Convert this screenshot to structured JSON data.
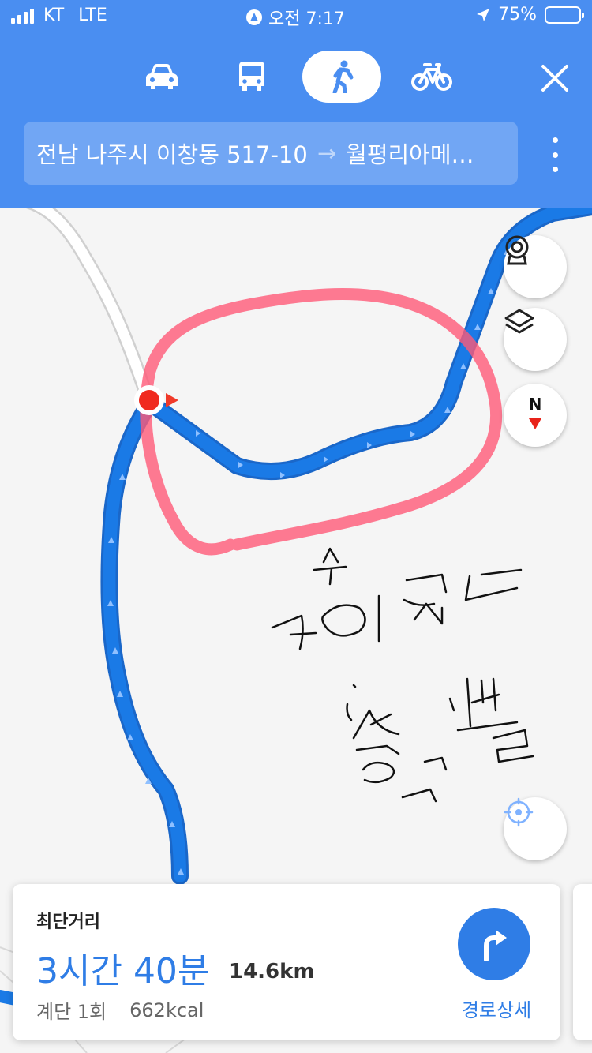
{
  "status_bar": {
    "carrier": "KT",
    "network": "LTE",
    "time": "오전 7:17",
    "battery": "75%",
    "battery_level": 0.75
  },
  "header": {
    "transport_modes": [
      {
        "name": "car",
        "icon": "car-icon",
        "selected": false
      },
      {
        "name": "bus",
        "icon": "bus-icon",
        "selected": false
      },
      {
        "name": "walk",
        "icon": "walk-icon",
        "selected": true
      },
      {
        "name": "bike",
        "icon": "bike-icon",
        "selected": false
      }
    ],
    "route": {
      "origin": "전남 나주시 이창동 517-10",
      "arrow": "→",
      "destination": "월평리아메…"
    }
  },
  "map": {
    "controls": [
      "cctv-icon",
      "layers-icon",
      "compass-icon",
      "locate-icon"
    ],
    "compass_label": "N",
    "route_color": "#1a7ae6",
    "annotation_color": "#ff5a78"
  },
  "route_card": {
    "type": "최단거리",
    "duration": "3시간 40분",
    "distance": "14.6km",
    "stairs": "계단 1회",
    "calories": "662kcal",
    "detail_label": "경로상세",
    "accent": "#2f7de6"
  }
}
